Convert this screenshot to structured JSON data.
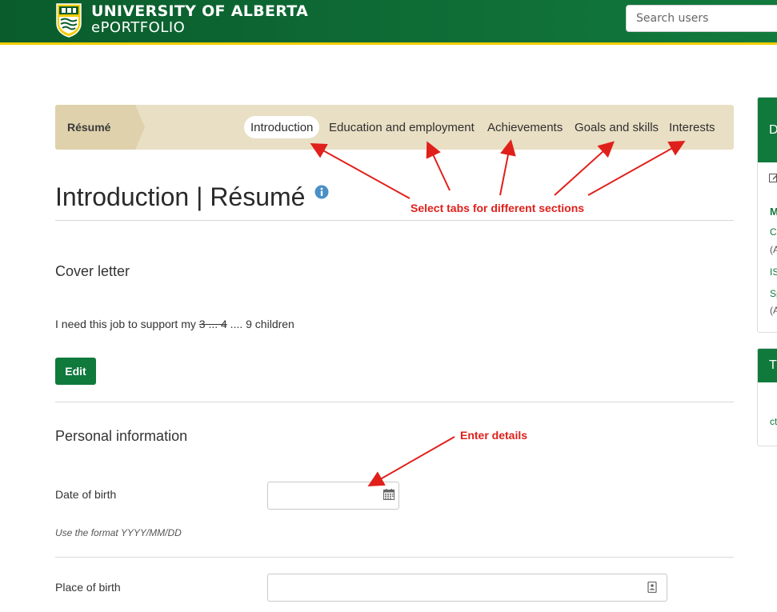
{
  "header": {
    "university": "UNIVERSITY OF ALBERTA",
    "product": "ePORTFOLIO",
    "search_placeholder": "Search users"
  },
  "tabbar": {
    "title": "Résumé",
    "tabs": [
      {
        "label": "Introduction",
        "active": true
      },
      {
        "label": "Education and employment",
        "active": false
      },
      {
        "label": "Achievements",
        "active": false
      },
      {
        "label": "Goals and skills",
        "active": false
      },
      {
        "label": "Interests",
        "active": false
      }
    ]
  },
  "page": {
    "title": "Introduction | Résumé"
  },
  "cover_letter": {
    "heading": "Cover letter",
    "text_before": "I need this job to support my ",
    "text_struck": "3 ... 4",
    "text_after": " .... 9 children",
    "edit_label": "Edit"
  },
  "personal_info": {
    "heading": "Personal information",
    "dob_label": "Date of birth",
    "dob_value": "",
    "dob_hint": "Use the format YYYY/MM/DD",
    "pob_label": "Place of birth",
    "pob_value": ""
  },
  "annotations": {
    "tabs_note": "Select tabs for different sections",
    "details_note": "Enter details"
  },
  "side": {
    "panel1_head": "D",
    "panel1_items": [
      {
        "text": "M",
        "style": "strong"
      },
      {
        "text": "C",
        "style": "link"
      },
      {
        "text": "(A",
        "style": "muted"
      },
      {
        "text": "IS",
        "style": "link"
      },
      {
        "text": "Sp",
        "style": "link"
      },
      {
        "text": "(A",
        "style": "muted"
      }
    ],
    "panel2_head": "T",
    "panel2_items": [
      {
        "text": "ct",
        "style": "link"
      }
    ]
  },
  "colors": {
    "brand_green": "#0f7a3c",
    "brand_gold": "#f2cd00",
    "annotation_red": "#e0201b",
    "tabbar_bg": "#e9dfc4"
  },
  "icons": {
    "crest": "university-crest-icon",
    "info": "info-icon",
    "calendar": "calendar-icon",
    "contact_card": "contact-card-icon",
    "edit": "edit-icon"
  }
}
